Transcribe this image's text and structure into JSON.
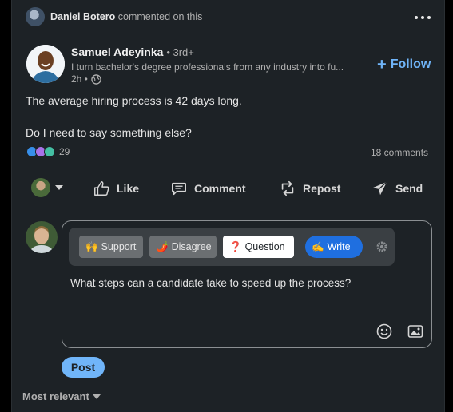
{
  "activity": {
    "actor": "Daniel Botero",
    "action": "commented on this",
    "avatar_icon": "user-avatar-icon",
    "menu_icon": "more-horizontal-icon"
  },
  "post": {
    "author": "Samuel Adeyinka",
    "degree": "• 3rd+",
    "headline": "I turn bachelor's degree professionals from any industry into fu...",
    "time": "2h •",
    "globe_icon": "globe-icon",
    "follow_label": "Follow",
    "text_line1": "The average hiring process is 42 days long.",
    "text_line2": "Do I need to say something else?",
    "reactions_count": "29",
    "comments_count": "18 comments",
    "reaction_icons": [
      "like-reaction-icon",
      "support-reaction-icon",
      "funny-reaction-icon"
    ]
  },
  "actions": {
    "like": "Like",
    "comment": "Comment",
    "repost": "Repost",
    "send": "Send"
  },
  "composer": {
    "chips": {
      "support": "Support",
      "disagree": "Disagree",
      "question": "Question",
      "write": "Write"
    },
    "chip_emojis": {
      "support": "🙌",
      "disagree": "🌶️",
      "question": "❓",
      "write": "✍️"
    },
    "text": "What steps can a candidate take to speed up the process?",
    "post_label": "Post"
  },
  "sort": {
    "label": "Most relevant"
  },
  "colors": {
    "accent": "#70b5f9",
    "write_chip": "#1f6fe0",
    "background": "#1d2226"
  }
}
